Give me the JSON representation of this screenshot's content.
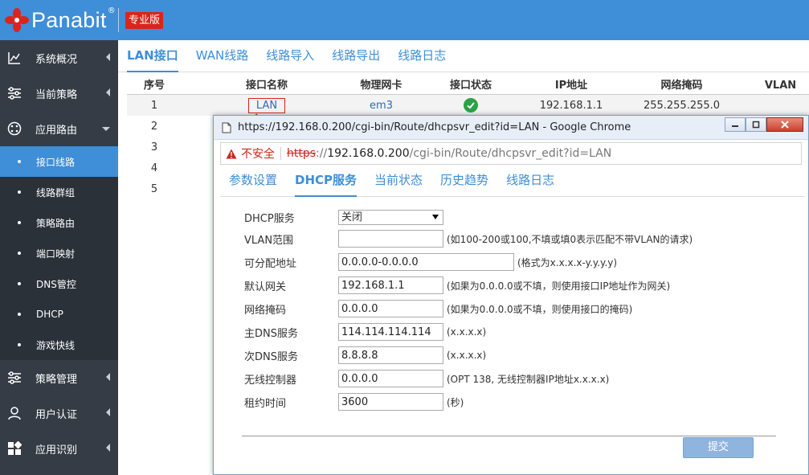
{
  "brand": {
    "logo_text": "Panabit",
    "registered_mark": "®",
    "edition": "专业版",
    "colors": {
      "header": "#3e8ed8",
      "sidebar": "#353c46",
      "edition_badge": "#d9251c"
    }
  },
  "sidebar": {
    "items": [
      {
        "label": "系统概况",
        "icon": "line-chart-icon"
      },
      {
        "label": "当前策略",
        "icon": "sliders-icon"
      },
      {
        "label": "应用路由",
        "icon": "route-icon",
        "expanded": true
      }
    ],
    "sub_items": [
      {
        "label": "接口线路",
        "active": true
      },
      {
        "label": "线路群组"
      },
      {
        "label": "策略路由"
      },
      {
        "label": "端口映射"
      },
      {
        "label": "DNS管控"
      },
      {
        "label": "DHCP"
      },
      {
        "label": "游戏快线"
      }
    ],
    "bottom_items": [
      {
        "label": "策略管理",
        "icon": "sliders-icon"
      },
      {
        "label": "用户认证",
        "icon": "user-icon"
      },
      {
        "label": "应用识别",
        "icon": "grid-icon"
      }
    ]
  },
  "main_tabs": [
    "LAN接口",
    "WAN线路",
    "线路导入",
    "线路导出",
    "线路日志"
  ],
  "table": {
    "headers": [
      "序号",
      "接口名称",
      "物理网卡",
      "接口状态",
      "IP地址",
      "网络掩码",
      "VLAN"
    ],
    "row1": {
      "no": "1",
      "name": "LAN",
      "nic": "em3",
      "ip": "192.168.1.1",
      "mask": "255.255.255.0",
      "vlan": ""
    },
    "other_rows": [
      "2",
      "3",
      "4",
      "5"
    ]
  },
  "popup": {
    "window_title": "https://192.168.0.200/cgi-bin/Route/dhcpsvr_edit?id=LAN - Google Chrome",
    "address": {
      "warning": "不安全",
      "scheme": "https",
      "sep": "://",
      "host": "192.168.0.200",
      "path": "/cgi-bin/Route/dhcpsvr_edit?id=LAN"
    },
    "tabs": [
      "参数设置",
      "DHCP服务",
      "当前状态",
      "历史趋势",
      "线路日志"
    ],
    "form": {
      "dhcp_service": {
        "label": "DHCP服务",
        "value": "关闭"
      },
      "vlan_range": {
        "label": "VLAN范围",
        "value": "",
        "hint": "(如100-200或100,不填或填0表示匹配不带VLAN的请求)"
      },
      "addr_pool": {
        "label": "可分配地址",
        "value": "0.0.0.0-0.0.0.0",
        "hint": "(格式为x.x.x.x-y.y.y.y)"
      },
      "gateway": {
        "label": "默认网关",
        "value": "192.168.1.1",
        "hint": "(如果为0.0.0.0或不填，则使用接口IP地址作为网关)"
      },
      "netmask": {
        "label": "网络掩码",
        "value": "0.0.0.0",
        "hint": "(如果为0.0.0.0或不填，则使用接口的掩码)"
      },
      "dns1": {
        "label": "主DNS服务",
        "value": "114.114.114.114",
        "hint": "(x.x.x.x)"
      },
      "dns2": {
        "label": "次DNS服务",
        "value": "8.8.8.8",
        "hint": "(x.x.x.x)"
      },
      "wlc": {
        "label": "无线控制器",
        "value": "0.0.0.0",
        "hint": "(OPT 138, 无线控制器IP地址x.x.x.x)"
      },
      "lease": {
        "label": "租约时间",
        "value": "3600",
        "hint": "(秒)"
      }
    },
    "submit_label": "提交"
  }
}
